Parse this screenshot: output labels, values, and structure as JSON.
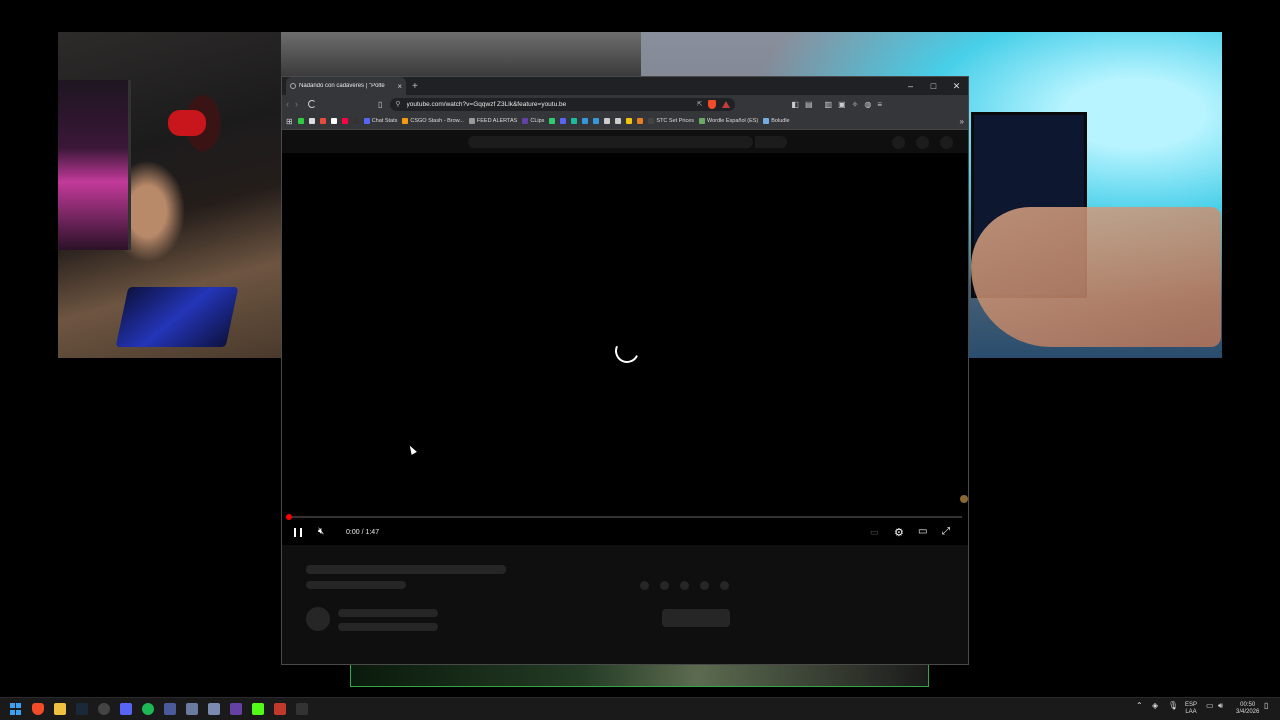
{
  "browser": {
    "tab_title": "Nadando con cadáveres | \"Polte",
    "url": "youtube.com/watch?v=Gqqwzf Z3Llk&feature=youtu.be",
    "bookmarks": [
      {
        "label": "",
        "color": "#2ecc40"
      },
      {
        "label": "",
        "color": "#dddddd"
      },
      {
        "label": "",
        "color": "#e74c3c"
      },
      {
        "label": "",
        "color": "#ffffff"
      },
      {
        "label": "",
        "color": "#ff0044"
      },
      {
        "label": "",
        "color": "#333333"
      },
      {
        "label": "Chat Stats",
        "color": "#5865f2"
      },
      {
        "label": "CSGO Stash - Brow...",
        "color": "#f39c12"
      },
      {
        "label": "FEED ALERTAS",
        "color": "#999999"
      },
      {
        "label": "CLips",
        "color": "#6441a5"
      },
      {
        "label": "",
        "color": "#2ecc71"
      },
      {
        "label": "",
        "color": "#5865f2"
      },
      {
        "label": "",
        "color": "#1abc9c"
      },
      {
        "label": "",
        "color": "#3498db"
      },
      {
        "label": "",
        "color": "#3498db"
      },
      {
        "label": "",
        "color": "#cccccc"
      },
      {
        "label": "",
        "color": "#cccccc"
      },
      {
        "label": "",
        "color": "#f1c40f"
      },
      {
        "label": "",
        "color": "#e67e22"
      },
      {
        "label": "STC Set Prices",
        "color": "#444444"
      },
      {
        "label": "Wordle Español (ES)",
        "color": "#6aaa64"
      },
      {
        "label": "Boludle",
        "color": "#74acdf"
      }
    ]
  },
  "player": {
    "time": "0:00 / 1:47",
    "progress_fraction": 0.0
  },
  "taskbar": {
    "lang_top": "ESP",
    "lang_bottom": "LAA",
    "clock_time": "00:50",
    "clock_date": "3/4/2026"
  },
  "colors": {
    "youtube_red": "#ff0000",
    "brave_orange": "#f14b2a",
    "frame_green": "#2fa84a"
  }
}
